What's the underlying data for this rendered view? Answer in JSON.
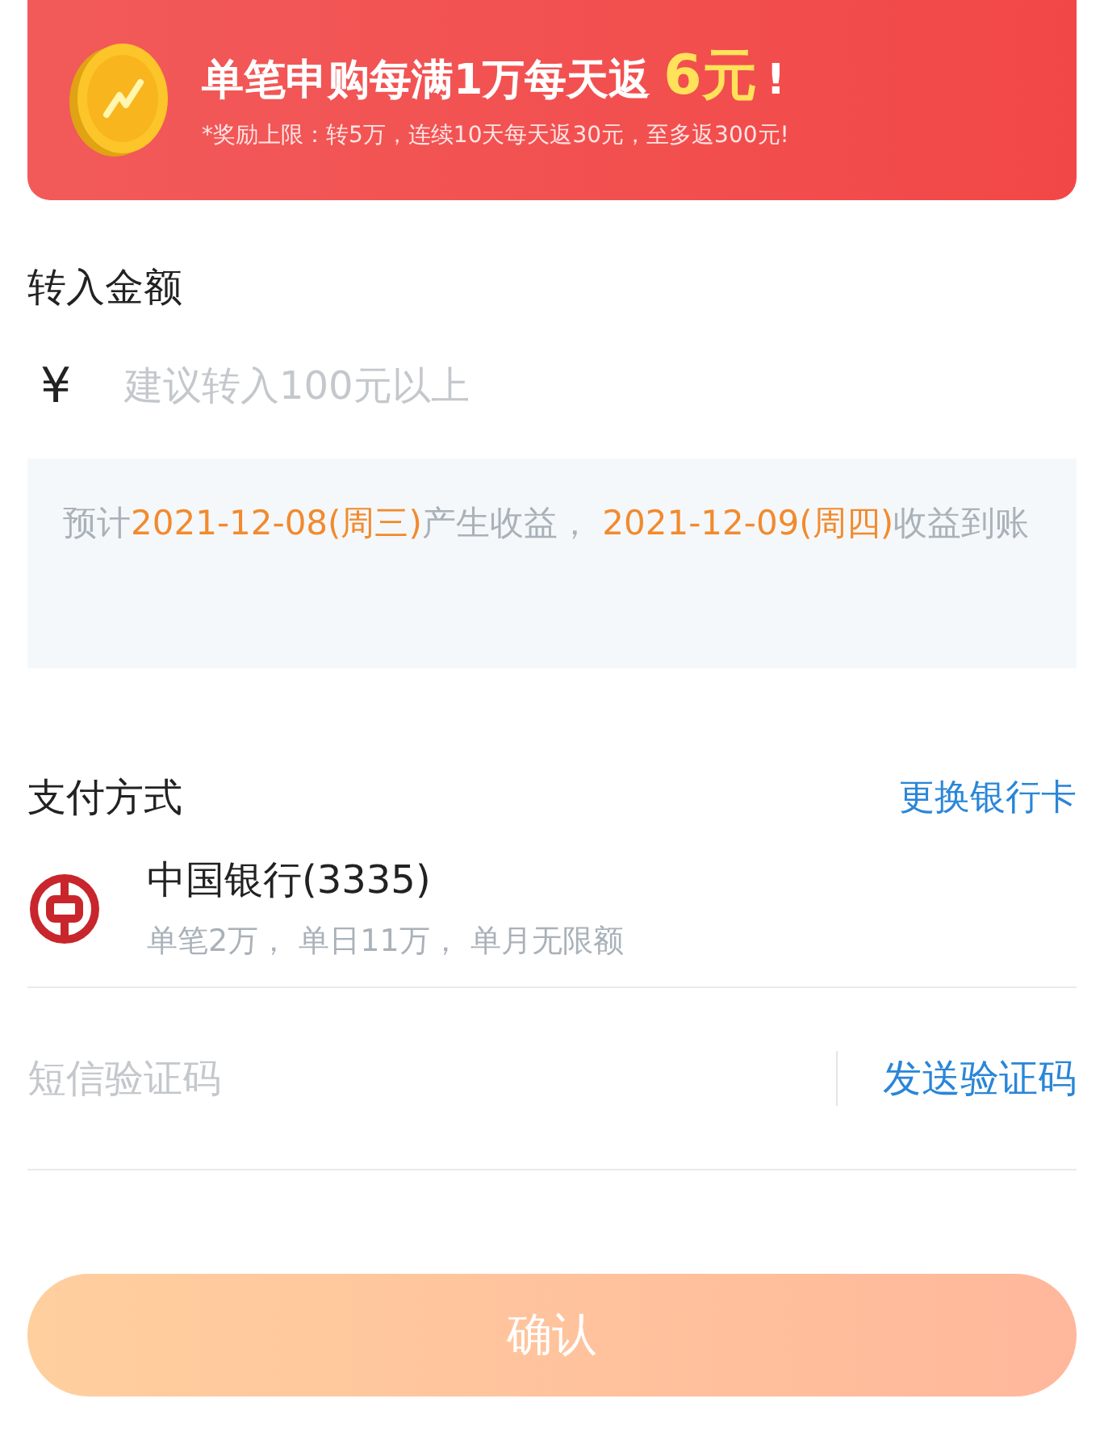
{
  "banner": {
    "headline": "单笔申购每满1万每天返",
    "amount": "6元",
    "suffix": "!",
    "note": "*奖励上限：转5万，连续10天每天返30元，至多返300元!"
  },
  "amount": {
    "label": "转入金额",
    "currency": "¥",
    "placeholder": "建议转入100元以上"
  },
  "schedule": [
    {
      "text": "预计",
      "highlight": false
    },
    {
      "text": "2021-12-08(周三)",
      "highlight": true
    },
    {
      "text": "产生收益， ",
      "highlight": false
    },
    {
      "text": "2021-12-09(周四)",
      "highlight": true
    },
    {
      "text": "收益到账",
      "highlight": false
    }
  ],
  "payment": {
    "title": "支付方式",
    "change_link": "更换银行卡",
    "bank_name": "中国银行(3335)",
    "limits": "单笔2万， 单日11万， 单月无限额"
  },
  "sms": {
    "placeholder": "短信验证码",
    "send_button": "发送验证码"
  },
  "confirm": {
    "label": "确认",
    "disabled": true
  }
}
